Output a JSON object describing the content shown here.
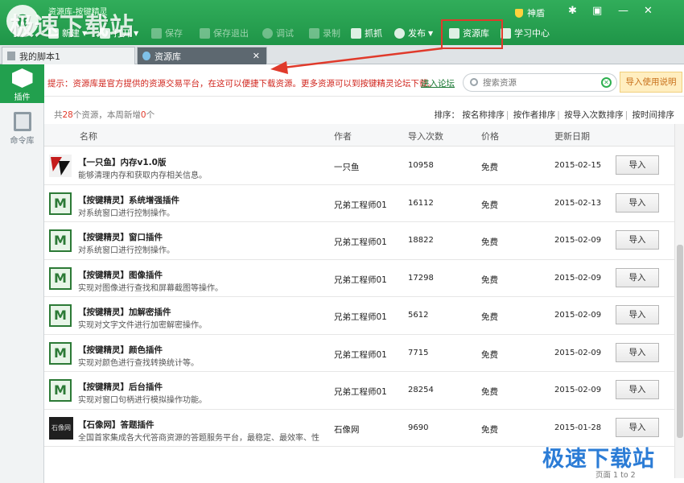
{
  "app": {
    "title": "资源库-按键精灵",
    "logo_text": "8",
    "watermark_top": "极速下载站",
    "watermark_bottom": "极速下载站"
  },
  "toolbar": {
    "new_label": "新建",
    "open_label": "打开",
    "save_label": "保存",
    "save_exit_label": "保存退出",
    "debug_label": "调试",
    "record_label": "录制",
    "capture_label": "抓抓",
    "publish_label": "发布",
    "resource_label": "资源库",
    "learn_label": "学习中心"
  },
  "window": {
    "god_shield": "神盾",
    "settings": "✱",
    "skin": "▣",
    "minimize": "—",
    "close": "✕"
  },
  "tabs": [
    {
      "label": "我的脚本1"
    },
    {
      "label": "资源库",
      "close": "✕"
    }
  ],
  "sidebar": {
    "items": [
      {
        "label": "插件"
      },
      {
        "label": "命令库"
      }
    ]
  },
  "notice": {
    "text": "提示：资源库是官方提供的资源交易平台，在这可以便捷下载资源。更多资源可以到按键精灵论坛下载。",
    "link": "进入论坛"
  },
  "search": {
    "placeholder": "搜索资源",
    "clear": "✕"
  },
  "guide_button": "导入使用说明",
  "summary": {
    "prefix": "共",
    "count": "28",
    "suffix": "个资源，本周新增",
    "week_count": "0",
    "unit": "个"
  },
  "sort": {
    "label": "排序：",
    "options": [
      "按名称排序",
      "按作者排序",
      "按导入次数排序",
      "按时间排序"
    ],
    "separator": "|"
  },
  "columns": {
    "name": "名称",
    "author": "作者",
    "imports": "导入次数",
    "price": "价格",
    "date": "更新日期"
  },
  "rows": [
    {
      "name": "【一只鱼】内存v1.0版",
      "desc": "能够清理内存和获取内存相关信息。",
      "author": "一只鱼",
      "imports": "10958",
      "price": "免费",
      "date": "2015-02-15",
      "button": "导入",
      "icon": "fish-icon"
    },
    {
      "name": "【按键精灵】系统增强插件",
      "desc": "对系统窗口进行控制操作。",
      "author": "兄弟工程师01",
      "imports": "16112",
      "price": "免费",
      "date": "2015-02-13",
      "button": "导入",
      "icon": "plugin-m-icon"
    },
    {
      "name": "【按键精灵】窗口插件",
      "desc": "对系统窗口进行控制操作。",
      "author": "兄弟工程师01",
      "imports": "18822",
      "price": "免费",
      "date": "2015-02-09",
      "button": "导入",
      "icon": "plugin-m-icon"
    },
    {
      "name": "【按键精灵】图像插件",
      "desc": "实现对图像进行查找和屏幕截图等操作。",
      "author": "兄弟工程师01",
      "imports": "17298",
      "price": "免费",
      "date": "2015-02-09",
      "button": "导入",
      "icon": "plugin-m-icon"
    },
    {
      "name": "【按键精灵】加解密插件",
      "desc": "实现对文字文件进行加密解密操作。",
      "author": "兄弟工程师01",
      "imports": "5612",
      "price": "免费",
      "date": "2015-02-09",
      "button": "导入",
      "icon": "plugin-m-icon"
    },
    {
      "name": "【按键精灵】颜色插件",
      "desc": "实现对颜色进行查找转换统计等。",
      "author": "兄弟工程师01",
      "imports": "7715",
      "price": "免费",
      "date": "2015-02-09",
      "button": "导入",
      "icon": "plugin-m-icon"
    },
    {
      "name": "【按键精灵】后台插件",
      "desc": "实现对窗口句柄进行模拟操作功能。",
      "author": "兄弟工程师01",
      "imports": "28254",
      "price": "免费",
      "date": "2015-02-09",
      "button": "导入",
      "icon": "plugin-m-icon"
    },
    {
      "name": "【石像网】答题插件",
      "desc": "全国首家集成各大代答商资源的答题服务平台，最稳定、最效率、性",
      "author": "石像网",
      "imports": "9690",
      "price": "免费",
      "date": "2015-01-28",
      "button": "导入",
      "icon": "stone-icon",
      "icon_text": "石像网"
    }
  ],
  "pager": {
    "label": "页面",
    "value": "1 to 2"
  },
  "colors": {
    "brand_green": "#22a04e",
    "notice_red": "#d0241c",
    "highlight_red": "#e03a2b"
  }
}
